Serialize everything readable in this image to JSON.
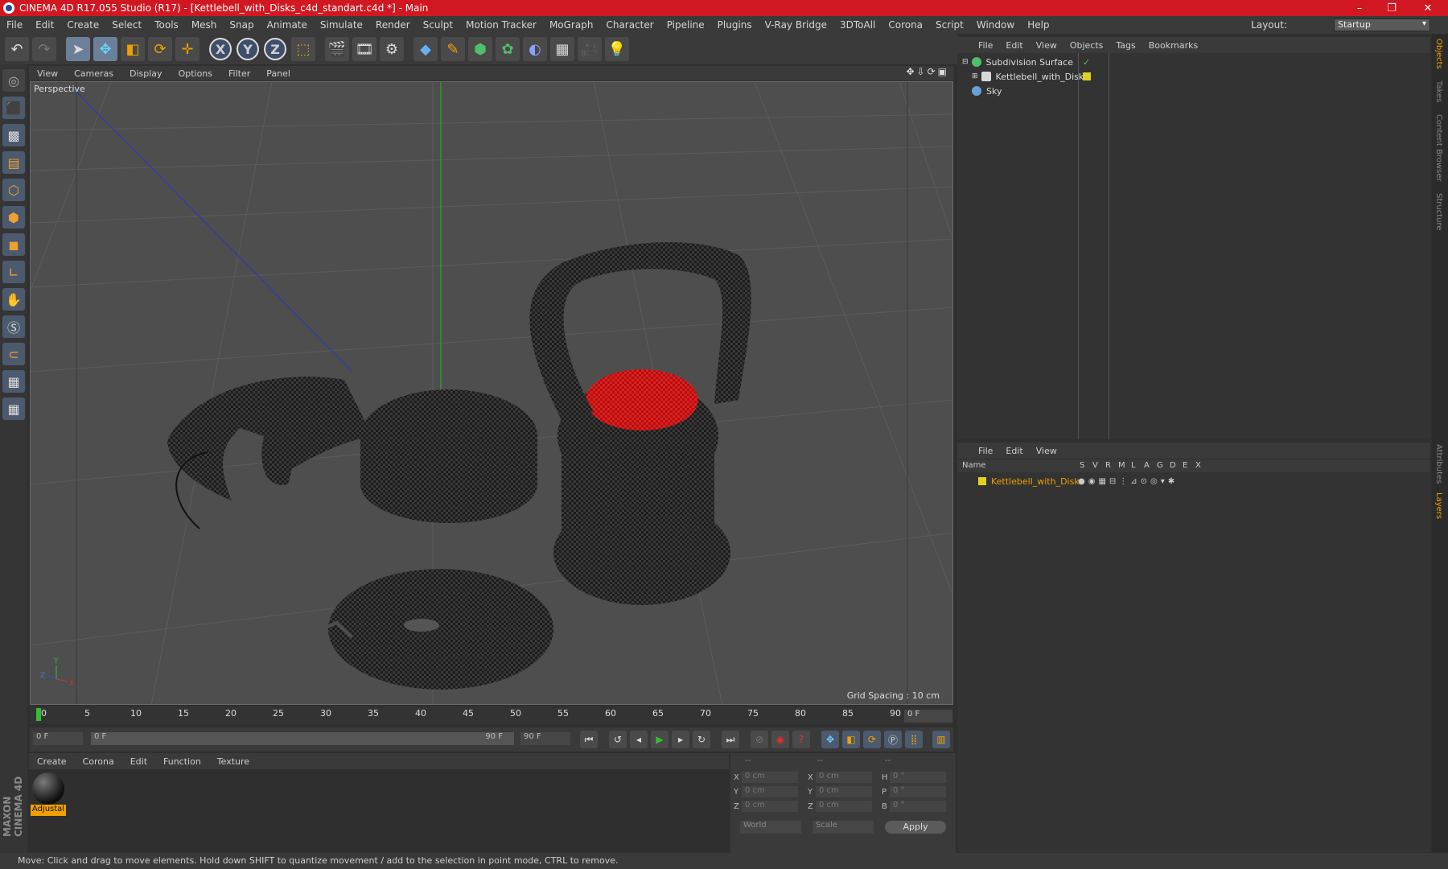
{
  "window": {
    "title": "CINEMA 4D R17.055 Studio (R17) - [Kettlebell_with_Disks_c4d_standart.c4d *] - Main",
    "controls": [
      "–",
      "❐",
      "✕"
    ]
  },
  "menubar": {
    "items": [
      "File",
      "Edit",
      "Create",
      "Select",
      "Tools",
      "Mesh",
      "Snap",
      "Animate",
      "Simulate",
      "Render",
      "Sculpt",
      "Motion Tracker",
      "MoGraph",
      "Character",
      "Pipeline",
      "Plugins",
      "V-Ray Bridge",
      "3DToAll",
      "Corona",
      "Script",
      "Window",
      "Help"
    ],
    "layout_label": "Layout:",
    "layout_value": "Startup"
  },
  "toolbar": {
    "axes": [
      "X",
      "Y",
      "Z"
    ]
  },
  "viewport": {
    "menu": [
      "View",
      "Cameras",
      "Display",
      "Options",
      "Filter",
      "Panel"
    ],
    "label": "Perspective",
    "grid_spacing": "Grid Spacing : 10 cm",
    "axis_labels": [
      "Y",
      "Z",
      "X"
    ]
  },
  "timeline": {
    "ticks": [
      "0",
      "5",
      "10",
      "15",
      "20",
      "25",
      "30",
      "35",
      "40",
      "45",
      "50",
      "55",
      "60",
      "65",
      "70",
      "75",
      "80",
      "85",
      "90"
    ],
    "end_frame": "0 F"
  },
  "playback": {
    "current_frame": "0 F",
    "range_start": "0 F",
    "range_end": "90 F",
    "max_frame": "90 F"
  },
  "material_manager": {
    "menu": [
      "Create",
      "Corona",
      "Edit",
      "Function",
      "Texture"
    ],
    "material_name": "Adjustal"
  },
  "coordinates": {
    "headers": [
      "--",
      "--",
      "--"
    ],
    "rows": [
      {
        "a": "X",
        "a_val": "0 cm",
        "b": "X",
        "b_val": "0 cm",
        "c": "H",
        "c_val": "0 °"
      },
      {
        "a": "Y",
        "a_val": "0 cm",
        "b": "Y",
        "b_val": "0 cm",
        "c": "P",
        "c_val": "0 °"
      },
      {
        "a": "Z",
        "a_val": "0 cm",
        "b": "Z",
        "b_val": "0 cm",
        "c": "B",
        "c_val": "0 °"
      }
    ],
    "coord_system": "World",
    "mode": "Scale",
    "apply_label": "Apply"
  },
  "object_manager": {
    "menu": [
      "File",
      "Edit",
      "View",
      "Objects",
      "Tags",
      "Bookmarks"
    ],
    "objects": [
      {
        "name": "Subdivision Surface",
        "icon_color": "#4fbf6a",
        "checkmark": "✓"
      },
      {
        "name": "Kettlebell_with_Disks",
        "icon_color": "#d8d8d8",
        "checkmark": ""
      },
      {
        "name": "Sky",
        "icon_color": "#6aa0d8",
        "checkmark": ""
      }
    ]
  },
  "layer_manager": {
    "menu": [
      "File",
      "Edit",
      "View"
    ],
    "columns": [
      "Name",
      "S",
      "V",
      "R",
      "M",
      "L",
      "A",
      "G",
      "D",
      "E",
      "X"
    ],
    "layers": [
      {
        "name": "Kettlebell_with_Disks",
        "color": "#e0d020"
      }
    ]
  },
  "right_tabs": [
    "Objects",
    "Takes",
    "Content Browser",
    "Structure",
    "Attributes",
    "Layers"
  ],
  "status": {
    "text": "Move: Click and drag to move elements. Hold down SHIFT to quantize movement / add to the selection in point mode, CTRL to remove."
  },
  "branding": {
    "maxon": "MAXON CINEMA 4D"
  }
}
